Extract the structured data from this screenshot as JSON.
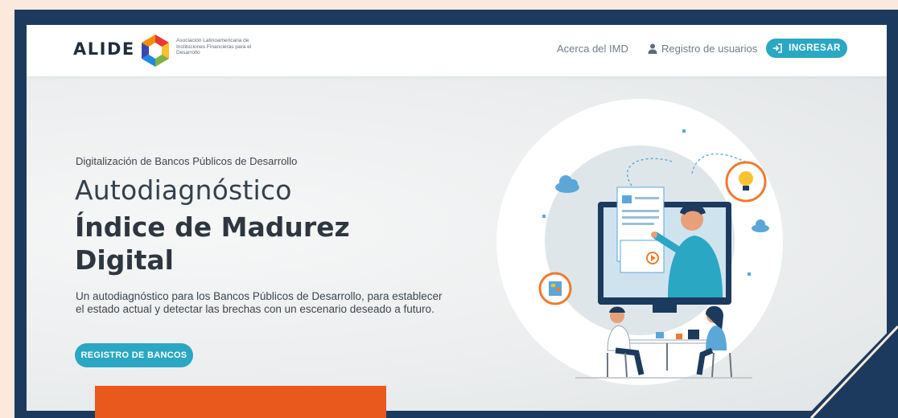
{
  "brand": {
    "name": "ALIDE",
    "tagline": "Asociación Latinoamericana de Instituciones Financieras para el Desarrollo"
  },
  "nav": {
    "about": "Acerca del IMD",
    "register_users": "Registro de usuarios",
    "login": "INGRESAR"
  },
  "hero": {
    "kicker": "Digitalización de Bancos Públicos de Desarrollo",
    "title_line1": "Autodiagnóstico",
    "title_line2": "Índice de Madurez Digital",
    "description": "Un autodiagnóstico para los Bancos Públicos de Desarrollo, para establecer el estado actual y detectar las brechas con un escenario deseado a futuro.",
    "cta": "REGISTRO DE BANCOS"
  },
  "colors": {
    "accent": "#2aa7c3",
    "navy": "#1c3a5e",
    "orange": "#e9581d",
    "background": "#fbe9dd"
  },
  "icons": {
    "user": "user-icon",
    "login": "login-icon",
    "illustration": "online-meeting-illustration"
  }
}
